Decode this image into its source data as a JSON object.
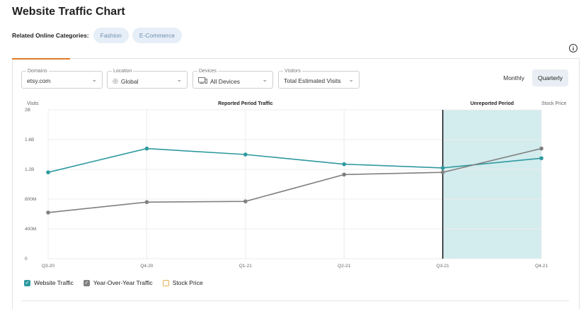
{
  "header": {
    "title": "Website Traffic Chart",
    "related_label": "Related Online Categories:",
    "categories": [
      "Fashion",
      "E-Commerce"
    ]
  },
  "info_icon": "info-icon",
  "filters": {
    "domains": {
      "label": "Domains",
      "value": "etsy.com"
    },
    "location": {
      "label": "Location",
      "value": "Global",
      "icon": "globe-icon"
    },
    "devices": {
      "label": "Devices",
      "value": "All Devices",
      "icon": "devices-icon"
    },
    "visitors": {
      "label": "Visitors",
      "value": "Total Estimated Visits"
    }
  },
  "period_toggle": {
    "monthly": "Monthly",
    "quarterly": "Quarterly",
    "selected": "Quarterly"
  },
  "colors": {
    "website_traffic": "#2e9a9f",
    "yoy_traffic": "#808080",
    "stock_price": "#e0b255",
    "unreported_fill": "#d3ecee",
    "accent": "#e07a2a"
  },
  "chart_data": {
    "type": "line",
    "y_axis_title": "Visits",
    "right_axis_title": "Stock Price",
    "reported_label": "Reported Period Traffic",
    "unreported_label": "Unreported Period",
    "categories": [
      "Q3-20",
      "Q4-20",
      "Q1-21",
      "Q2-21",
      "Q3-21",
      "Q4-21"
    ],
    "y_ticks": [
      {
        "value": 0,
        "label": "0"
      },
      {
        "value": 400000000,
        "label": "400M"
      },
      {
        "value": 800000000,
        "label": "800M"
      },
      {
        "value": 1200000000,
        "label": "1.2B"
      },
      {
        "value": 1600000000,
        "label": "1.6B"
      },
      {
        "value": 2000000000,
        "label": "2B"
      }
    ],
    "ylim": [
      0,
      2000000000
    ],
    "unreported_from_index": 4,
    "series": [
      {
        "name": "Website Traffic",
        "values": [
          1160000000,
          1480000000,
          1400000000,
          1270000000,
          1220000000,
          1350000000
        ],
        "checked": true
      },
      {
        "name": "Year-Over-Year Traffic",
        "values": [
          620000000,
          760000000,
          770000000,
          1130000000,
          1160000000,
          1480000000
        ],
        "checked": true
      },
      {
        "name": "Stock Price",
        "values": [],
        "checked": false
      }
    ],
    "grid": true
  }
}
